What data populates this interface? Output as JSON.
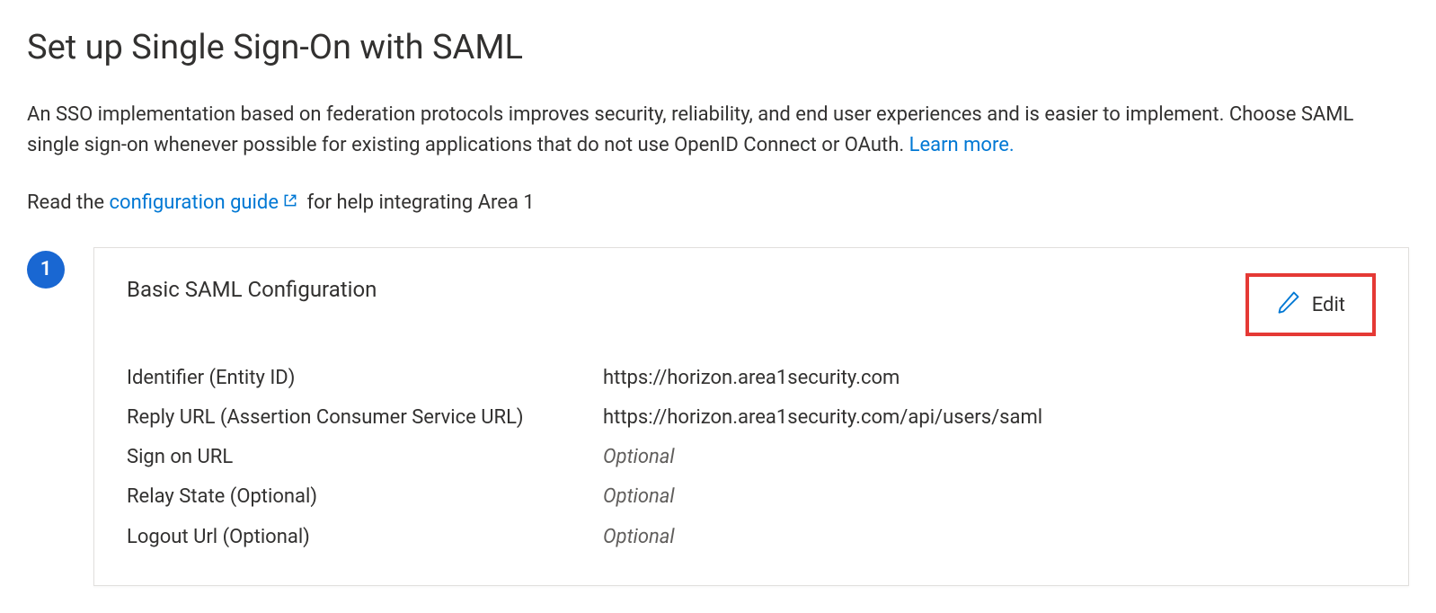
{
  "page": {
    "title": "Set up Single Sign-On with SAML",
    "description_before_link": "An SSO implementation based on federation protocols improves security, reliability, and end user experiences and is easier to implement. Choose SAML single sign-on whenever possible for existing applications that do not use OpenID Connect or OAuth. ",
    "learn_more_label": "Learn more.",
    "guide_prefix": "Read the ",
    "guide_link_label": "configuration guide",
    "guide_suffix": " for help integrating Area 1"
  },
  "step": {
    "number": "1",
    "card_title": "Basic SAML Configuration",
    "edit_label": "Edit",
    "rows": {
      "identifier_label": "Identifier (Entity ID)",
      "identifier_value": "https://horizon.area1security.com",
      "reply_label": "Reply URL (Assertion Consumer Service URL)",
      "reply_value": "https://horizon.area1security.com/api/users/saml",
      "signon_label": "Sign on URL",
      "signon_value": "Optional",
      "relay_label": "Relay State (Optional)",
      "relay_value": "Optional",
      "logout_label": "Logout Url (Optional)",
      "logout_value": "Optional"
    }
  }
}
